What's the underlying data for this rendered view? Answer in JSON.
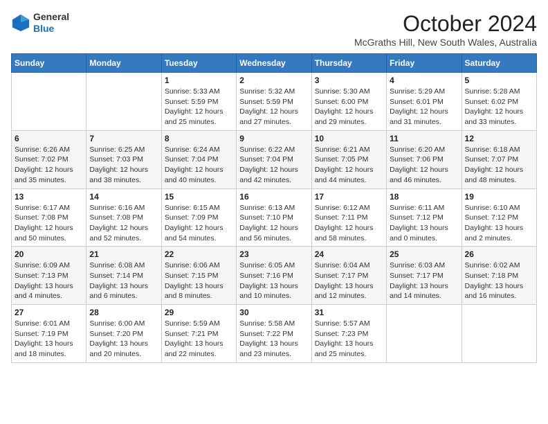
{
  "header": {
    "logo_line1": "General",
    "logo_line2": "Blue",
    "month_title": "October 2024",
    "location": "McGraths Hill, New South Wales, Australia"
  },
  "calendar": {
    "weekdays": [
      "Sunday",
      "Monday",
      "Tuesday",
      "Wednesday",
      "Thursday",
      "Friday",
      "Saturday"
    ],
    "weeks": [
      [
        {
          "day": "",
          "info": ""
        },
        {
          "day": "",
          "info": ""
        },
        {
          "day": "1",
          "info": "Sunrise: 5:33 AM\nSunset: 5:59 PM\nDaylight: 12 hours\nand 25 minutes."
        },
        {
          "day": "2",
          "info": "Sunrise: 5:32 AM\nSunset: 5:59 PM\nDaylight: 12 hours\nand 27 minutes."
        },
        {
          "day": "3",
          "info": "Sunrise: 5:30 AM\nSunset: 6:00 PM\nDaylight: 12 hours\nand 29 minutes."
        },
        {
          "day": "4",
          "info": "Sunrise: 5:29 AM\nSunset: 6:01 PM\nDaylight: 12 hours\nand 31 minutes."
        },
        {
          "day": "5",
          "info": "Sunrise: 5:28 AM\nSunset: 6:02 PM\nDaylight: 12 hours\nand 33 minutes."
        }
      ],
      [
        {
          "day": "6",
          "info": "Sunrise: 6:26 AM\nSunset: 7:02 PM\nDaylight: 12 hours\nand 35 minutes."
        },
        {
          "day": "7",
          "info": "Sunrise: 6:25 AM\nSunset: 7:03 PM\nDaylight: 12 hours\nand 38 minutes."
        },
        {
          "day": "8",
          "info": "Sunrise: 6:24 AM\nSunset: 7:04 PM\nDaylight: 12 hours\nand 40 minutes."
        },
        {
          "day": "9",
          "info": "Sunrise: 6:22 AM\nSunset: 7:04 PM\nDaylight: 12 hours\nand 42 minutes."
        },
        {
          "day": "10",
          "info": "Sunrise: 6:21 AM\nSunset: 7:05 PM\nDaylight: 12 hours\nand 44 minutes."
        },
        {
          "day": "11",
          "info": "Sunrise: 6:20 AM\nSunset: 7:06 PM\nDaylight: 12 hours\nand 46 minutes."
        },
        {
          "day": "12",
          "info": "Sunrise: 6:18 AM\nSunset: 7:07 PM\nDaylight: 12 hours\nand 48 minutes."
        }
      ],
      [
        {
          "day": "13",
          "info": "Sunrise: 6:17 AM\nSunset: 7:08 PM\nDaylight: 12 hours\nand 50 minutes."
        },
        {
          "day": "14",
          "info": "Sunrise: 6:16 AM\nSunset: 7:08 PM\nDaylight: 12 hours\nand 52 minutes."
        },
        {
          "day": "15",
          "info": "Sunrise: 6:15 AM\nSunset: 7:09 PM\nDaylight: 12 hours\nand 54 minutes."
        },
        {
          "day": "16",
          "info": "Sunrise: 6:13 AM\nSunset: 7:10 PM\nDaylight: 12 hours\nand 56 minutes."
        },
        {
          "day": "17",
          "info": "Sunrise: 6:12 AM\nSunset: 7:11 PM\nDaylight: 12 hours\nand 58 minutes."
        },
        {
          "day": "18",
          "info": "Sunrise: 6:11 AM\nSunset: 7:12 PM\nDaylight: 13 hours\nand 0 minutes."
        },
        {
          "day": "19",
          "info": "Sunrise: 6:10 AM\nSunset: 7:12 PM\nDaylight: 13 hours\nand 2 minutes."
        }
      ],
      [
        {
          "day": "20",
          "info": "Sunrise: 6:09 AM\nSunset: 7:13 PM\nDaylight: 13 hours\nand 4 minutes."
        },
        {
          "day": "21",
          "info": "Sunrise: 6:08 AM\nSunset: 7:14 PM\nDaylight: 13 hours\nand 6 minutes."
        },
        {
          "day": "22",
          "info": "Sunrise: 6:06 AM\nSunset: 7:15 PM\nDaylight: 13 hours\nand 8 minutes."
        },
        {
          "day": "23",
          "info": "Sunrise: 6:05 AM\nSunset: 7:16 PM\nDaylight: 13 hours\nand 10 minutes."
        },
        {
          "day": "24",
          "info": "Sunrise: 6:04 AM\nSunset: 7:17 PM\nDaylight: 13 hours\nand 12 minutes."
        },
        {
          "day": "25",
          "info": "Sunrise: 6:03 AM\nSunset: 7:17 PM\nDaylight: 13 hours\nand 14 minutes."
        },
        {
          "day": "26",
          "info": "Sunrise: 6:02 AM\nSunset: 7:18 PM\nDaylight: 13 hours\nand 16 minutes."
        }
      ],
      [
        {
          "day": "27",
          "info": "Sunrise: 6:01 AM\nSunset: 7:19 PM\nDaylight: 13 hours\nand 18 minutes."
        },
        {
          "day": "28",
          "info": "Sunrise: 6:00 AM\nSunset: 7:20 PM\nDaylight: 13 hours\nand 20 minutes."
        },
        {
          "day": "29",
          "info": "Sunrise: 5:59 AM\nSunset: 7:21 PM\nDaylight: 13 hours\nand 22 minutes."
        },
        {
          "day": "30",
          "info": "Sunrise: 5:58 AM\nSunset: 7:22 PM\nDaylight: 13 hours\nand 23 minutes."
        },
        {
          "day": "31",
          "info": "Sunrise: 5:57 AM\nSunset: 7:23 PM\nDaylight: 13 hours\nand 25 minutes."
        },
        {
          "day": "",
          "info": ""
        },
        {
          "day": "",
          "info": ""
        }
      ]
    ]
  }
}
